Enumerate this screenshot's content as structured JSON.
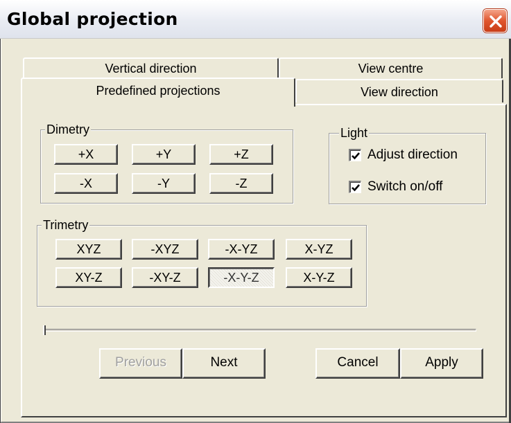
{
  "window": {
    "title": "Global projection"
  },
  "tabs": {
    "row_back": [
      "Vertical direction",
      "View centre"
    ],
    "row_front": [
      "Predefined projections",
      "View direction"
    ],
    "active": "Predefined projections"
  },
  "dimetry": {
    "label": "Dimetry",
    "buttons": [
      "+X",
      "+Y",
      "+Z",
      "-X",
      "-Y",
      "-Z"
    ]
  },
  "light": {
    "label": "Light",
    "options": [
      {
        "label": "Adjust direction",
        "checked": true
      },
      {
        "label": "Switch on/off",
        "checked": true
      }
    ]
  },
  "trimetry": {
    "label": "Trimetry",
    "buttons": [
      "XYZ",
      "-XYZ",
      "-X-YZ",
      "X-YZ",
      "XY-Z",
      "-XY-Z",
      "-X-Y-Z",
      "X-Y-Z"
    ],
    "pressed": "-X-Y-Z"
  },
  "slider": {
    "value": 0
  },
  "footer": {
    "previous": "Previous",
    "next": "Next",
    "cancel": "Cancel",
    "apply": "Apply"
  },
  "colors": {
    "close_button": "#e0562e",
    "dialog_bg": "#ece9d8"
  }
}
